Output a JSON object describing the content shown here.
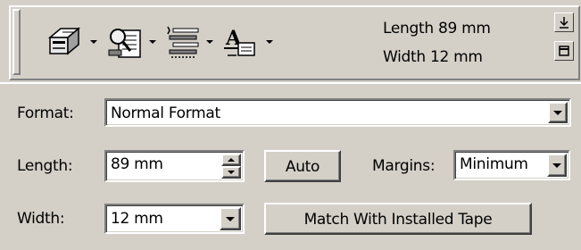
{
  "toolbar": {
    "icons": [
      "print-icon",
      "print-preview-icon",
      "layout-icon",
      "text-format-icon"
    ],
    "length_text": "Length 89 mm",
    "width_text": "Width 12 mm",
    "dock_buttons": [
      "dock-down-icon",
      "restore-icon"
    ]
  },
  "format": {
    "label": "Format:",
    "value": "Normal Format"
  },
  "length": {
    "label": "Length:",
    "value": "89 mm",
    "auto_label": "Auto"
  },
  "margins": {
    "label": "Margins:",
    "value": "Minimum"
  },
  "width": {
    "label": "Width:",
    "value": "12 mm",
    "match_label": "Match With Installed Tape"
  }
}
